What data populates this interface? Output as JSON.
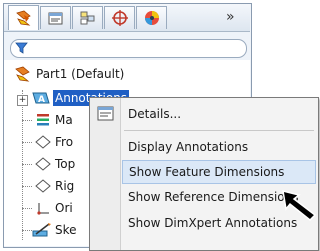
{
  "tabs": [
    {
      "name": "feature-manager-tab",
      "icon": "feature-manager-icon",
      "active": true
    },
    {
      "name": "property-manager-tab",
      "icon": "property-manager-icon",
      "active": false
    },
    {
      "name": "configuration-manager-tab",
      "icon": "configuration-manager-icon",
      "active": false
    },
    {
      "name": "dimxpert-manager-tab",
      "icon": "dimxpert-manager-icon",
      "active": false
    },
    {
      "name": "display-manager-tab",
      "icon": "display-manager-icon",
      "active": false
    }
  ],
  "overflow": "»",
  "tree": {
    "part": "Part1  (Default)",
    "annotations": "Annotations",
    "material": "Ma",
    "front": "Fro",
    "top": "Top",
    "right": "Rig",
    "origin": "Ori",
    "sketch": "Ske"
  },
  "menu": {
    "details": "Details...",
    "display_annotations": "Display Annotations",
    "show_feature_dimensions": "Show Feature Dimensions",
    "show_reference_dimensions": "Show Reference Dimensions",
    "show_dimxpert_annotations": "Show DimXpert Annotations"
  },
  "colors": {
    "selection": "#1f5fc4",
    "menu_highlight": "#dbe8f7",
    "accent_orange": "#f39c12"
  }
}
